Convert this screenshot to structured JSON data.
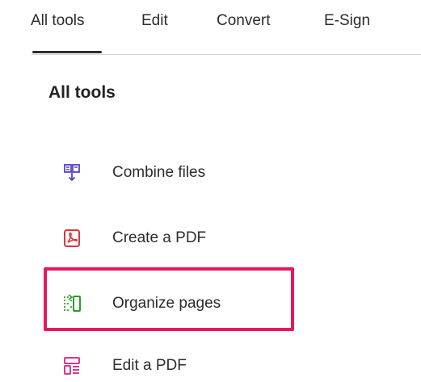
{
  "tabs": [
    {
      "label": "All tools",
      "active": true
    },
    {
      "label": "Edit",
      "active": false
    },
    {
      "label": "Convert",
      "active": false
    },
    {
      "label": "E-Sign",
      "active": false
    }
  ],
  "section_title": "All tools",
  "tools": [
    {
      "label": "Combine files",
      "icon": "combine-files-icon",
      "color": "#5a3fbf"
    },
    {
      "label": "Create a PDF",
      "icon": "create-pdf-icon",
      "color": "#d7373f"
    },
    {
      "label": "Organize pages",
      "icon": "organize-pages-icon",
      "color": "#2d9d2a",
      "highlighted": true
    },
    {
      "label": "Edit a PDF",
      "icon": "edit-pdf-icon",
      "color": "#d83790"
    }
  ],
  "highlight_color": "#e8175d"
}
